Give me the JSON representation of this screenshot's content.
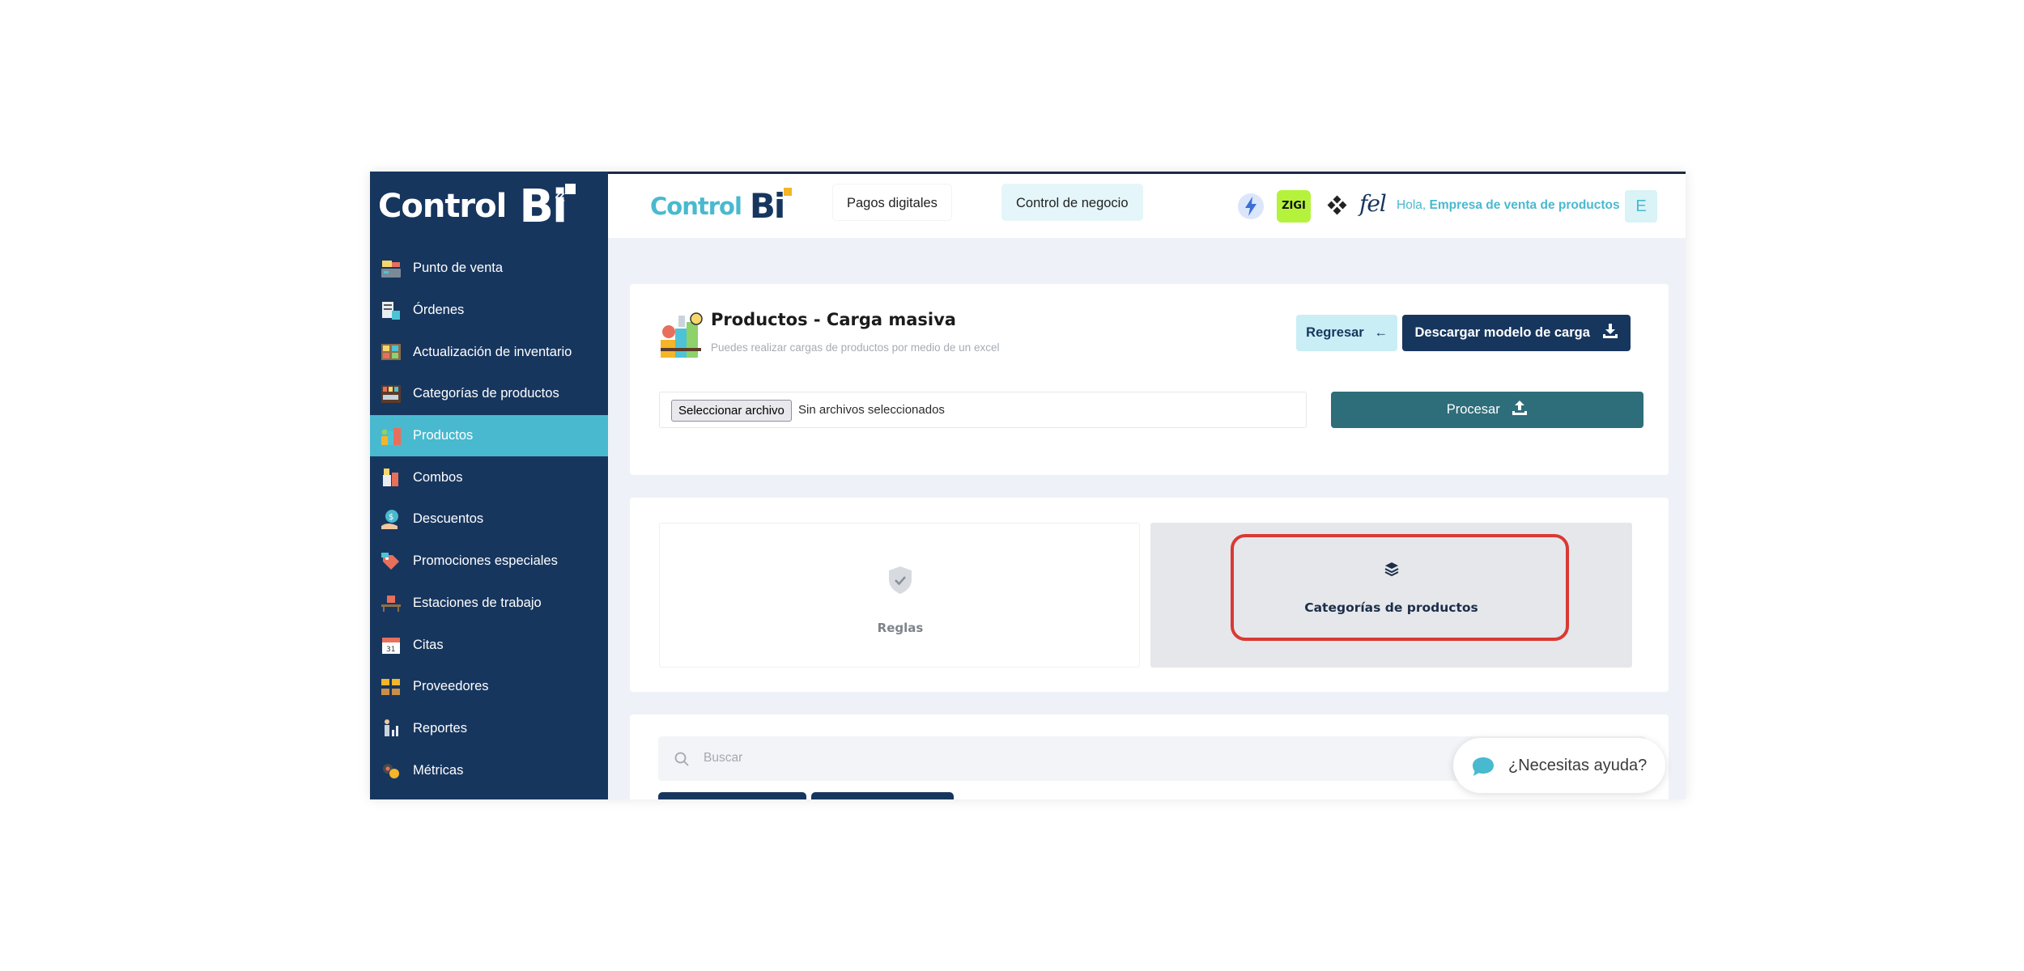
{
  "sidebar": {
    "logo_control": "Control",
    "logo_bi": "Bi",
    "collapse_icon": "«",
    "items": [
      {
        "label": "Punto de venta",
        "icon": "cash-register-icon"
      },
      {
        "label": "Órdenes",
        "icon": "orders-icon"
      },
      {
        "label": "Actualización de inventario",
        "icon": "inventory-icon"
      },
      {
        "label": "Categorías de productos",
        "icon": "categories-icon"
      },
      {
        "label": "Productos",
        "icon": "products-icon",
        "active": true
      },
      {
        "label": "Combos",
        "icon": "combos-icon"
      },
      {
        "label": "Descuentos",
        "icon": "discount-icon"
      },
      {
        "label": "Promociones especiales",
        "icon": "promotion-icon"
      },
      {
        "label": "Estaciones de trabajo",
        "icon": "workstation-icon"
      },
      {
        "label": "Citas",
        "icon": "calendar-icon"
      },
      {
        "label": "Proveedores",
        "icon": "suppliers-icon"
      },
      {
        "label": "Reportes",
        "icon": "reports-icon"
      },
      {
        "label": "Métricas",
        "icon": "metrics-icon"
      }
    ]
  },
  "header": {
    "logo_control": "Control",
    "logo_bi": "Bi",
    "tabs": [
      {
        "label": "Pagos digitales"
      },
      {
        "label": "Control de negocio",
        "active": true
      }
    ],
    "zigi_label": "ZIGI",
    "fel_label": "fel",
    "greeting": "Hola,",
    "company": "Empresa de venta de productos",
    "avatar_letter": "E"
  },
  "upload": {
    "title": "Productos - Carga masiva",
    "subtitle": "Puedes realizar cargas de productos por medio de un excel",
    "back_label": "Regresar",
    "back_icon": "←",
    "download_label": "Descargar modelo de carga",
    "file_button": "Seleccionar archivo",
    "file_status": "Sin archivos seleccionados",
    "process_label": "Procesar"
  },
  "tabs_panel": {
    "rules_label": "Reglas",
    "categories_label": "Categorías de productos"
  },
  "search": {
    "placeholder": "Buscar"
  },
  "help": {
    "label": "¿Necesitas ayuda?"
  },
  "colors": {
    "sidebar_bg": "#17365e",
    "accent": "#49b9cf",
    "process_btn": "#2e6d7a",
    "highlight": "#d93a33",
    "logo_square": "#f4b529"
  }
}
